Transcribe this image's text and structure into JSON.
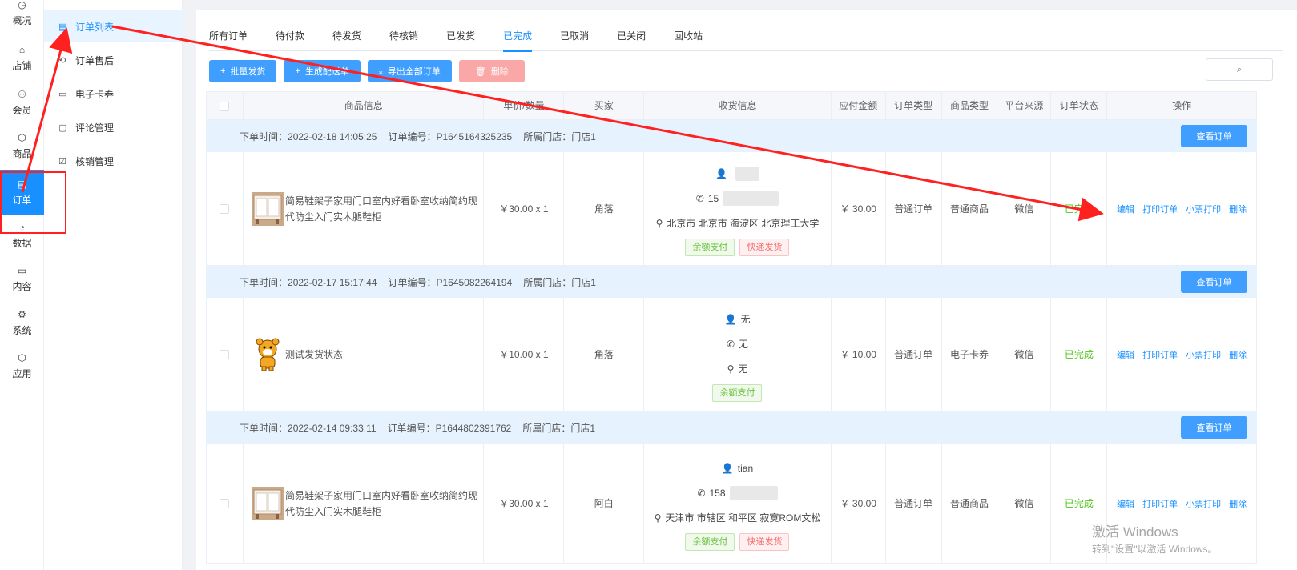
{
  "rail": [
    {
      "name": "overview",
      "icon": "◷",
      "label": "概况"
    },
    {
      "name": "store",
      "icon": "⌂",
      "label": "店铺"
    },
    {
      "name": "member",
      "icon": "⚇",
      "label": "会员"
    },
    {
      "name": "goods",
      "icon": "⬡",
      "label": "商品"
    },
    {
      "name": "order",
      "icon": "▤",
      "label": "订单"
    },
    {
      "name": "data",
      "icon": "◔",
      "label": "数据"
    },
    {
      "name": "content",
      "icon": "▭",
      "label": "内容"
    },
    {
      "name": "system",
      "icon": "⚙",
      "label": "系统"
    },
    {
      "name": "apps",
      "icon": "⬡",
      "label": "应用"
    }
  ],
  "submenu": [
    {
      "icon": "▤",
      "label": "订单列表"
    },
    {
      "icon": "⟲",
      "label": "订单售后"
    },
    {
      "icon": "▭",
      "label": "电子卡券"
    },
    {
      "icon": "▢",
      "label": "评论管理"
    },
    {
      "icon": "☑",
      "label": "核销管理"
    }
  ],
  "tabs": [
    "所有订单",
    "待付款",
    "待发货",
    "待核销",
    "已发货",
    "已完成",
    "已取消",
    "已关闭",
    "回收站"
  ],
  "toolbar": {
    "batch_ship": "批量发货",
    "gen_delivery": "生成配送单",
    "export_all": "导出全部订单",
    "delete": "删除"
  },
  "search_icon": "search-icon",
  "columns": [
    "商品信息",
    "单价/数量",
    "买家",
    "收货信息",
    "应付金额",
    "订单类型",
    "商品类型",
    "平台来源",
    "订单状态",
    "操作"
  ],
  "labels": {
    "order_time": "下单时间：",
    "order_no": "订单编号：",
    "store": "所属门店：",
    "view_order": "查看订单"
  },
  "orders": [
    {
      "time": "2022-02-18 14:05:25",
      "no": "P1645164325235",
      "store": "门店1",
      "goods": "简易鞋架子家用门口室内好看卧室收纳简约现代防尘入门实木腿鞋柜",
      "price_qty": "￥30.00 x 1",
      "buyer": "角落",
      "recv_name": "",
      "recv_phone": "15",
      "recv_addr": "北京市 北京市 海淀区 北京理工大学",
      "amount": "￥ 30.00",
      "order_type": "普通订单",
      "goods_type": "普通商品",
      "source": "微信",
      "status": "已完成",
      "tag_pay": "余额支付",
      "tag_ship": "快递发货"
    },
    {
      "time": "2022-02-17 15:17:44",
      "no": "P1645082264194",
      "store": "门店1",
      "goods": "测试发货状态",
      "price_qty": "￥10.00 x 1",
      "buyer": "角落",
      "recv_name": "无",
      "recv_phone": "无",
      "recv_addr": "无",
      "amount": "￥ 10.00",
      "order_type": "普通订单",
      "goods_type": "电子卡券",
      "source": "微信",
      "status": "已完成",
      "tag_pay": "余额支付",
      "tag_ship": ""
    },
    {
      "time": "2022-02-14 09:33:11",
      "no": "P1644802391762",
      "store": "门店1",
      "goods": "简易鞋架子家用门口室内好看卧室收纳简约现代防尘入门实木腿鞋柜",
      "price_qty": "￥30.00 x 1",
      "buyer": "阿白",
      "recv_name": "tian",
      "recv_phone": "158",
      "recv_addr": "天津市 市辖区 和平区 寂寞ROM文松",
      "amount": "￥ 30.00",
      "order_type": "普通订单",
      "goods_type": "普通商品",
      "source": "微信",
      "status": "已完成",
      "tag_pay": "余额支付",
      "tag_ship": "快递发货"
    }
  ],
  "ops": [
    "编辑",
    "打印订单",
    "小票打印",
    "删除"
  ],
  "watermark": {
    "line1": "激活 Windows",
    "line2": "转到\"设置\"以激活 Windows。"
  },
  "colors": {
    "primary": "#1890ff",
    "success": "#52c41a",
    "annotation": "#ff0000"
  }
}
